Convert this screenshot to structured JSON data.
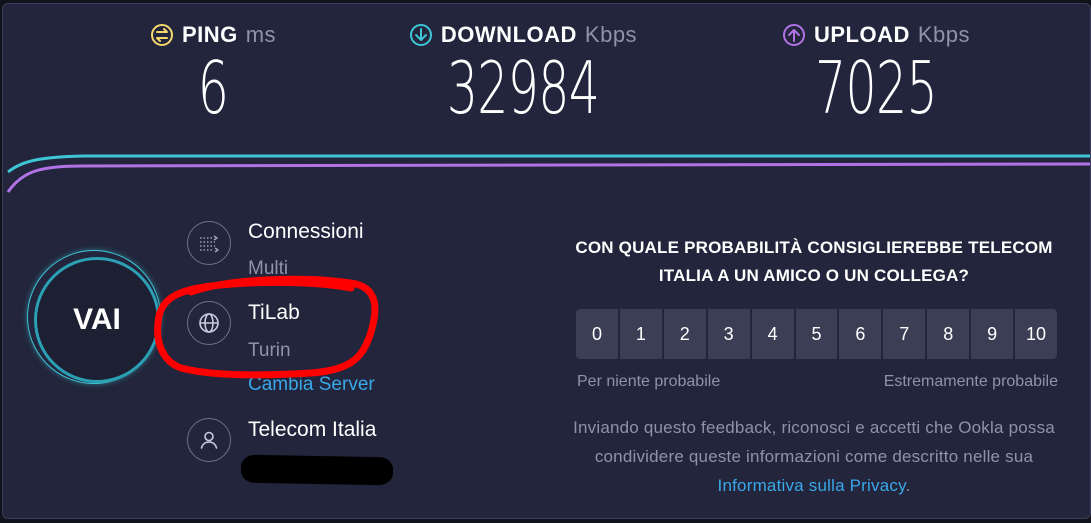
{
  "metrics": {
    "ping": {
      "label": "PING",
      "unit": "ms",
      "value": "6",
      "color": "#f5d86b"
    },
    "download": {
      "label": "DOWNLOAD",
      "unit": "Kbps",
      "value": "32984",
      "color": "#3ec6d6"
    },
    "upload": {
      "label": "UPLOAD",
      "unit": "Kbps",
      "value": "7025",
      "color": "#b173e6"
    }
  },
  "go_button": {
    "label": "VAI"
  },
  "connections": {
    "title": "Connessioni",
    "value": "Multi"
  },
  "server": {
    "name": "TiLab",
    "location": "Turin",
    "change_label": "Cambia Server"
  },
  "provider": {
    "name": "Telecom Italia"
  },
  "survey": {
    "question": "CON QUALE PROBABILITÀ CONSIGLIEREBBE TELECOM ITALIA A UN AMICO O UN COLLEGA?",
    "scale": [
      "0",
      "1",
      "2",
      "3",
      "4",
      "5",
      "6",
      "7",
      "8",
      "9",
      "10"
    ],
    "low_label": "Per niente probabile",
    "high_label": "Estremamente probabile",
    "disclaimer": "Inviando questo feedback, riconosci e accetti che Ookla possa condividere queste informazioni come descritto nelle sua",
    "privacy_link": "Informativa sulla Privacy",
    "disclaimer_end": "."
  },
  "colors": {
    "accent_cyan": "#3ec6d6",
    "accent_purple": "#b173e6",
    "annotation_red": "#ff0000",
    "background": "#22253b"
  }
}
